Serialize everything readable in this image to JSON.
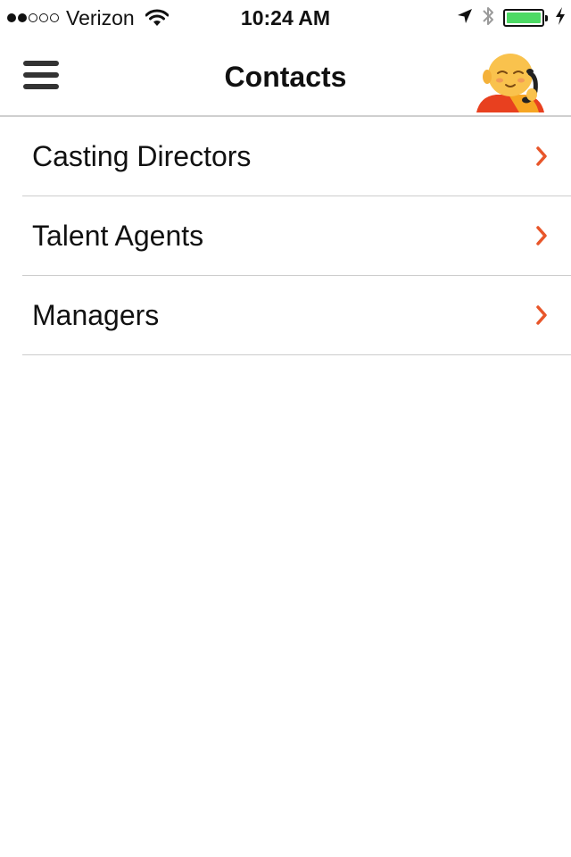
{
  "status_bar": {
    "carrier": "Verizon",
    "signal_strength": {
      "filled": 2,
      "total": 5
    },
    "time": "10:24 AM",
    "battery_level_percent": 100,
    "battery_color": "#4cd964",
    "icons": [
      "wifi-icon",
      "location-arrow-icon",
      "bluetooth-icon",
      "battery-icon",
      "charging-bolt-icon"
    ]
  },
  "nav": {
    "title": "Contacts",
    "menu_icon": "hamburger-menu-icon",
    "avatar_icon": "monk-on-phone-avatar"
  },
  "accent_color": "#e8562a",
  "contacts": {
    "items": [
      {
        "label": "Casting Directors"
      },
      {
        "label": "Talent Agents"
      },
      {
        "label": "Managers"
      }
    ]
  }
}
